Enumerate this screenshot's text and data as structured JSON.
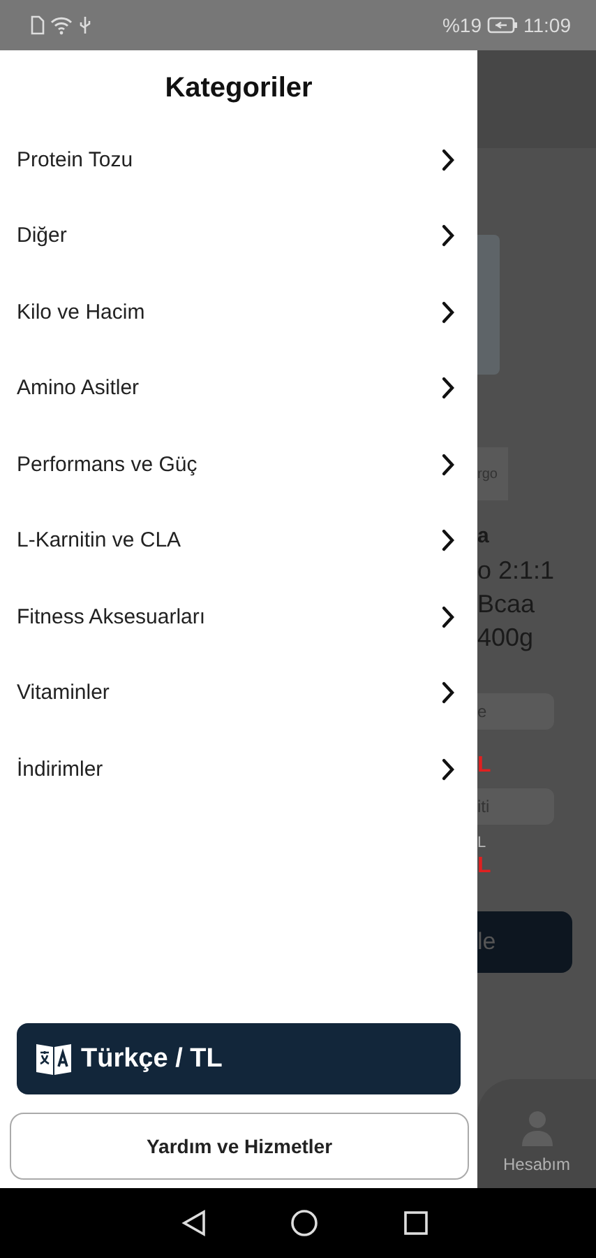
{
  "status_bar": {
    "battery": "%19",
    "time": "11:09"
  },
  "drawer": {
    "title": "Kategoriler",
    "items": [
      {
        "label": "Protein Tozu"
      },
      {
        "label": "Diğer"
      },
      {
        "label": "Kilo ve Hacim"
      },
      {
        "label": "Amino Asitler"
      },
      {
        "label": "Performans ve Güç"
      },
      {
        "label": "L-Karnitin ve CLA"
      },
      {
        "label": "Fitness Aksesuarları"
      },
      {
        "label": "Vitaminler"
      },
      {
        "label": "İndirimler"
      }
    ],
    "language_button": "Türkçe / TL",
    "help_button": "Yardım ve Hizmetler"
  },
  "background_page": {
    "tag": "rgo",
    "brand": "a",
    "name_lines": [
      "o 2:1:1",
      "Bcaa",
      "400g"
    ],
    "pill_1": "e",
    "price_1": "L",
    "pill_2": "iti",
    "old_price": "L",
    "price_2": "L",
    "action_button": "le",
    "nav_item": "Hesabım"
  }
}
